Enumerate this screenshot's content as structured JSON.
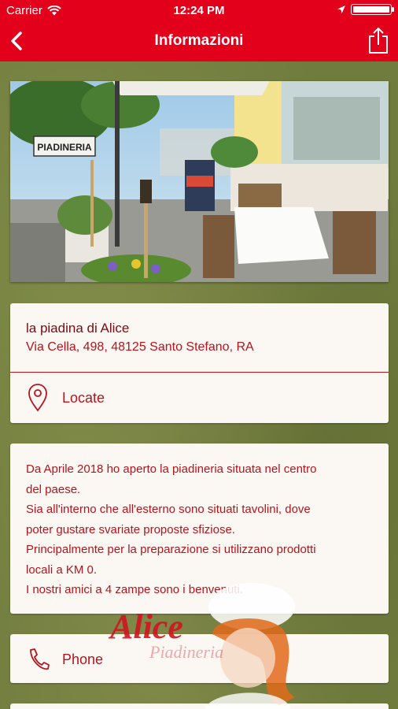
{
  "status_bar": {
    "carrier": "Carrier",
    "time": "12:24 PM"
  },
  "nav": {
    "title": "Informazioni",
    "back_icon": "chevron-left-icon",
    "share_icon": "share-icon"
  },
  "colors": {
    "brand_red": "#e2001a",
    "text_red": "#b4141e",
    "card_bg": "#fbf8f3",
    "background_green": "#707c3e"
  },
  "photo": {
    "sign_text": "PIADINERIA"
  },
  "address_card": {
    "name": "la piadina di Alice",
    "address": "Via Cella, 498, 48125 Santo Stefano, RA",
    "locate_label": "Locate",
    "locate_icon": "map-pin-icon"
  },
  "description": {
    "lines": [
      "Da Aprile 2018 ho aperto la piadineria situata nel centro",
      "del paese.",
      "Sia all'interno che all'esterno sono situati tavolini, dove",
      "poter gustare svariate proposte sfiziose.",
      "Principalmente per la preparazione si utilizzano prodotti",
      "locali a KM 0.",
      "I nostri amici a 4 zampe sono i benvenuti."
    ]
  },
  "phone_card": {
    "label": "Phone",
    "icon": "phone-icon"
  },
  "logo": {
    "brand": "Alice",
    "tagline": "Piadineria"
  }
}
